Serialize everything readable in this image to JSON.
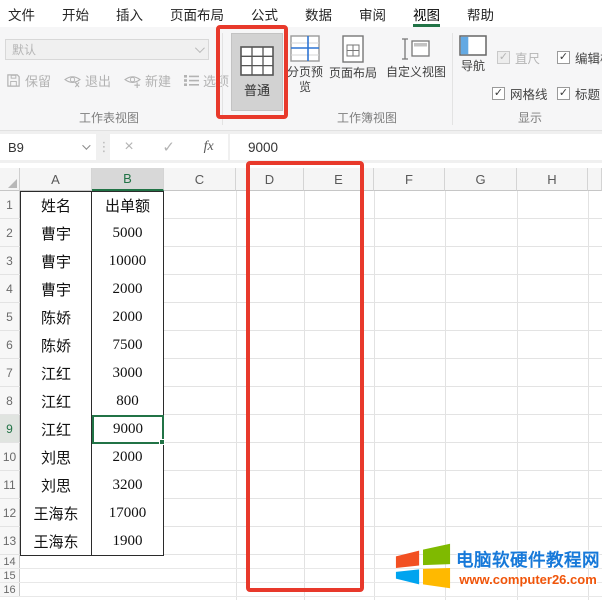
{
  "menu": {
    "tabs": [
      "文件",
      "开始",
      "插入",
      "页面布局",
      "公式",
      "数据",
      "审阅",
      "视图",
      "帮助"
    ],
    "active_tab": "视图"
  },
  "ribbon": {
    "sheet_view_group": {
      "label": "工作表视图",
      "view_dropdown_value": "默认",
      "keep_button": "保留",
      "exit_button": "退出",
      "new_button": "新建",
      "options_button": "选项"
    },
    "workbook_view_group": {
      "label": "工作簿视图",
      "normal_button": "普通",
      "page_break_preview_button": "分页预览",
      "page_layout_button": "页面布局",
      "custom_view_button": "自定义视图"
    },
    "display_group": {
      "label": "显示",
      "navigation_button": "导航",
      "ruler_checkbox": "直尺",
      "formula_bar_checkbox": "编辑栏",
      "gridlines_checkbox": "网格线",
      "headings_checkbox": "标题"
    }
  },
  "formula_bar": {
    "name_box": "B9",
    "cancel_glyph": "×",
    "enter_glyph": "✓",
    "fx_label": "fx",
    "dots_glyph": "⋮",
    "value": "9000"
  },
  "sheet": {
    "columns": [
      "A",
      "B",
      "C",
      "D",
      "E",
      "F",
      "G",
      "H"
    ],
    "selected_cell": "B9",
    "selected_column": "B",
    "selected_row": "9",
    "rows": [
      {
        "num": "1",
        "name": "姓名",
        "amount": "出单额"
      },
      {
        "num": "2",
        "name": "曹宇",
        "amount": "5000"
      },
      {
        "num": "3",
        "name": "曹宇",
        "amount": "10000"
      },
      {
        "num": "4",
        "name": "曹宇",
        "amount": "2000"
      },
      {
        "num": "5",
        "name": "陈娇",
        "amount": "2000"
      },
      {
        "num": "6",
        "name": "陈娇",
        "amount": "7500"
      },
      {
        "num": "7",
        "name": "江红",
        "amount": "3000"
      },
      {
        "num": "8",
        "name": "江红",
        "amount": "800"
      },
      {
        "num": "9",
        "name": "江红",
        "amount": "9000"
      },
      {
        "num": "10",
        "name": "刘思",
        "amount": "2000"
      },
      {
        "num": "11",
        "name": "刘思",
        "amount": "3200"
      },
      {
        "num": "12",
        "name": "王海东",
        "amount": "17000"
      },
      {
        "num": "13",
        "name": "王海东",
        "amount": "1900"
      }
    ],
    "empty_rows": [
      "14",
      "15",
      "16"
    ]
  },
  "watermark": {
    "site_name": "电脑软硬件教程网",
    "site_url": "www.computer26.com"
  },
  "colors": {
    "accent_green": "#217346",
    "annotation_red": "#e8392b",
    "selected_fill": "#d8d8d8"
  }
}
